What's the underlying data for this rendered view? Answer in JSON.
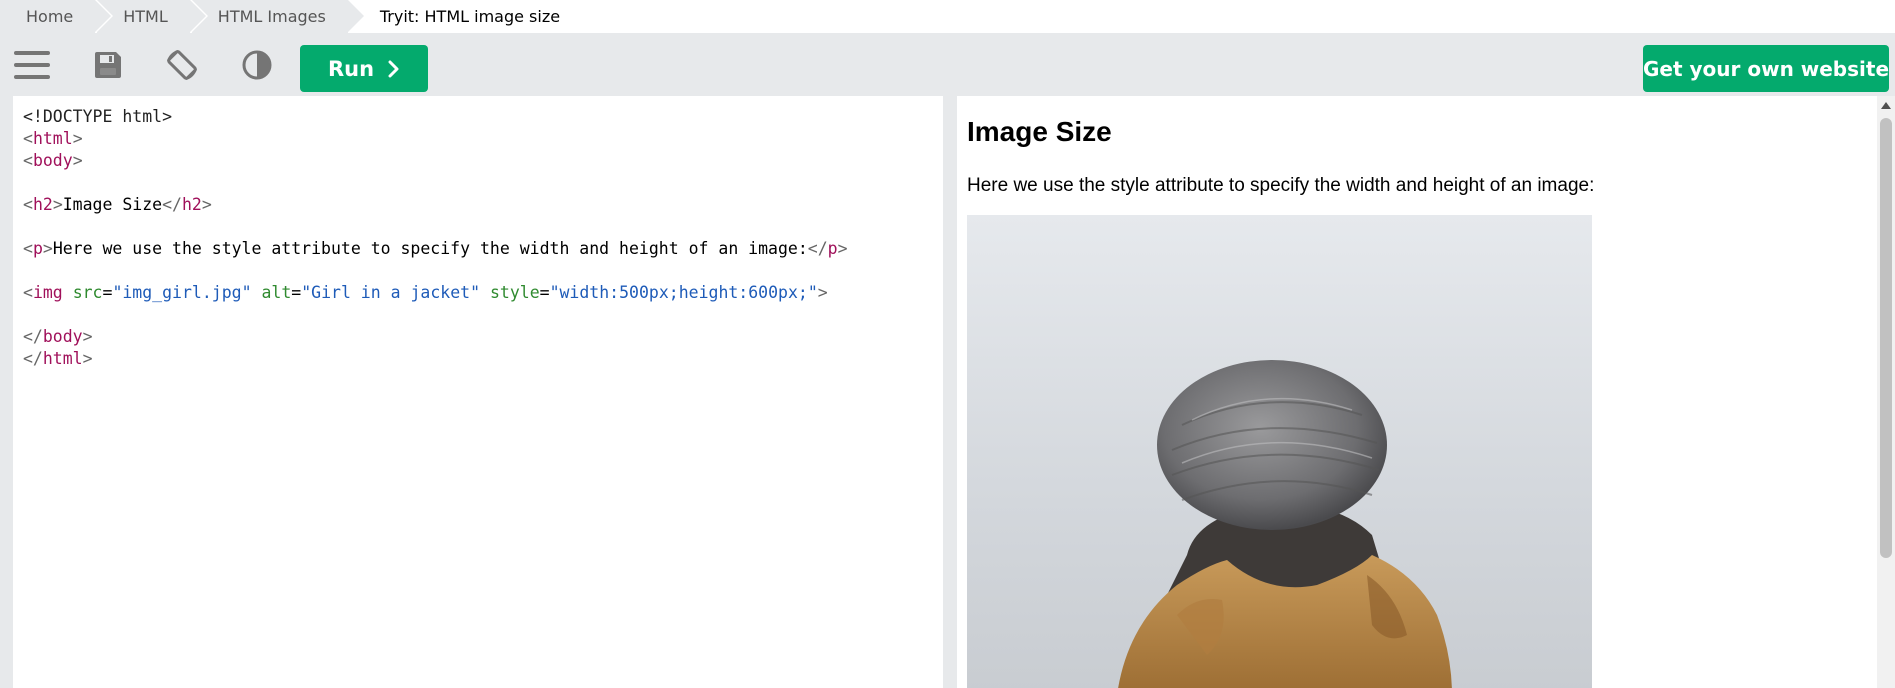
{
  "breadcrumb": {
    "items": [
      "Home",
      "HTML",
      "HTML Images"
    ],
    "current": "Tryit: HTML image size"
  },
  "toolbar": {
    "icons": [
      "menu-icon",
      "save-icon",
      "rotate-icon",
      "contrast-icon"
    ],
    "run_label": "Run",
    "run_icon": "chevron-right-icon",
    "get_website_label": "Get your own website"
  },
  "colors": {
    "accent_green": "#04aa6d",
    "toolbar_bg": "#e7e9eb",
    "code_tag": "#a0105a",
    "code_attr": "#2f8a2f",
    "code_value": "#1e5bb8"
  },
  "code": {
    "doctype": "<!DOCTYPE html>",
    "html_tag": "html",
    "body_tag": "body",
    "h2_tag": "h2",
    "h2_text": "Image Size",
    "p_tag": "p",
    "p_text": "Here we use the style attribute to specify the width and height of an image:",
    "img_tag": "img",
    "src_attr": "src",
    "src_value": "\"img_girl.jpg\"",
    "alt_attr": "alt",
    "alt_value": "\"Girl in a jacket\"",
    "style_attr": "style",
    "style_value": "\"width:500px;height:600px;\""
  },
  "result": {
    "heading": "Image Size",
    "paragraph": "Here we use the style attribute to specify the width and height of an image:",
    "image_alt": "Girl in a jacket"
  }
}
